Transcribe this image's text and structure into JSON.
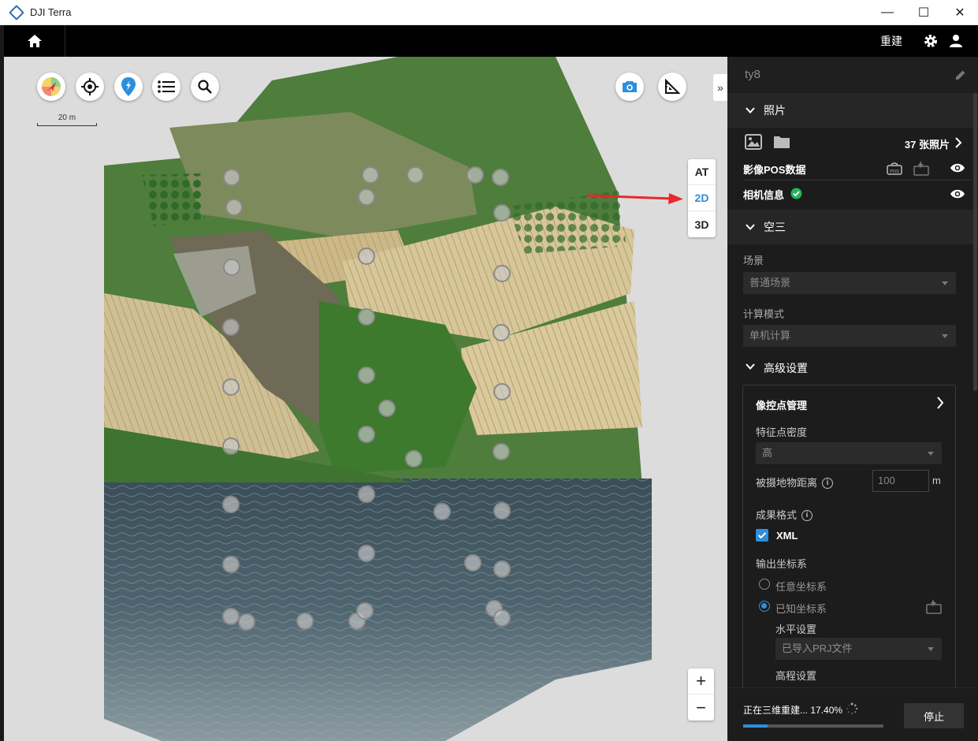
{
  "window": {
    "title": "DJI Terra",
    "controls": {
      "minimize": "—",
      "maximize": "☐",
      "close": "✕"
    }
  },
  "topbar": {
    "rebuild_label": "重建",
    "icons": [
      "home-icon",
      "gear-icon",
      "user-icon"
    ]
  },
  "map": {
    "tools": [
      "compass-icon",
      "locate-icon",
      "pin-icon",
      "list-icon",
      "search-icon"
    ],
    "right_tools": [
      "camera-icon",
      "measure-icon"
    ],
    "scale_label": "20 m",
    "expand_label": "»",
    "view_modes": [
      "AT",
      "2D",
      "3D"
    ],
    "active_view": "2D",
    "zoom_in": "+",
    "zoom_out": "−",
    "colors": {
      "arrow": "#e8282b",
      "accent": "#2c8fdc"
    }
  },
  "panel": {
    "project_name": "ty8",
    "photos": {
      "section_label": "照片",
      "count_label": "37 张照片",
      "pos_label": "影像POS数据",
      "camera_label": "相机信息"
    },
    "aerotriangulation": {
      "section_label": "空三",
      "scene_label": "场景",
      "scene_value": "普通场景",
      "compute_label": "计算模式",
      "compute_value": "单机计算"
    },
    "advanced": {
      "section_label": "高级设置",
      "gcp_label": "像控点管理",
      "density_label": "特征点密度",
      "density_value": "高",
      "distance_label": "被摄地物距离",
      "distance_value": "100",
      "distance_unit": "m",
      "format_label": "成果格式",
      "format_xml": "XML",
      "coord_label": "输出坐标系",
      "coord_arbitrary": "任意坐标系",
      "coord_known": "已知坐标系",
      "horizontal_label": "水平设置",
      "horizontal_value": "已导入PRJ文件",
      "elevation_label": "高程设置"
    },
    "status": {
      "text": "正在三维重建... 17.40%",
      "progress": 0.174,
      "stop_label": "停止"
    }
  }
}
